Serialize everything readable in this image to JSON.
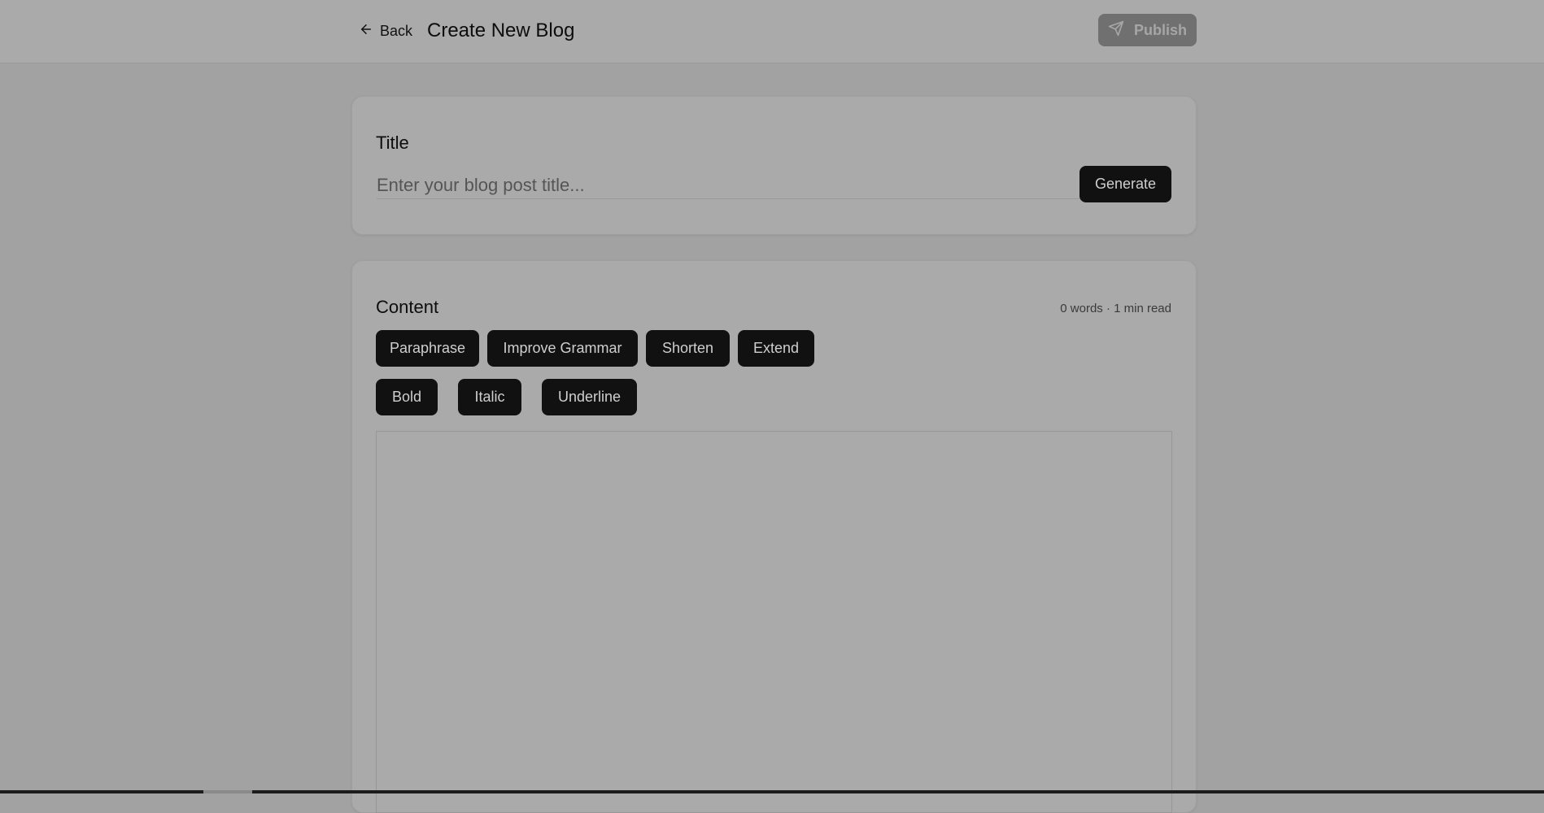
{
  "header": {
    "back_label": "Back",
    "page_title": "Create New Blog",
    "publish_label": "Publish"
  },
  "title_section": {
    "label": "Title",
    "placeholder": "Enter your blog post title...",
    "value": "",
    "generate_label": "Generate"
  },
  "content_section": {
    "label": "Content",
    "word_count": "0 words · 1 min read",
    "ai_actions": [
      "Paraphrase",
      "Improve Grammar",
      "Shorten",
      "Extend"
    ],
    "format_actions": [
      "Bold",
      "Italic",
      "Underline"
    ],
    "editor_text": ""
  },
  "icons": {
    "back": "arrow-left-icon",
    "publish": "send-icon"
  }
}
